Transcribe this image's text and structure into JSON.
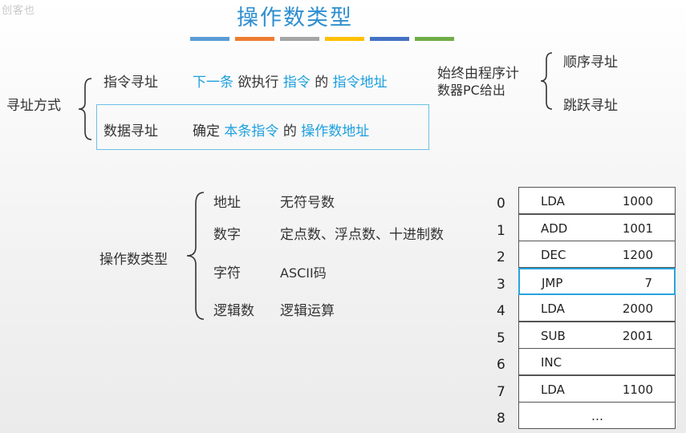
{
  "watermark": "创客也",
  "title": "操作数类型",
  "color_bars": [
    "#5b9bd5",
    "#ed7d31",
    "#a5a5a5",
    "#ffc000",
    "#4472c4",
    "#70ad47"
  ],
  "addressing": {
    "root": "寻址方式",
    "instruction": {
      "label": "指令寻址",
      "p1": "下一条",
      "p2": "欲执行",
      "p3": "指令",
      "p4": "的",
      "p5": "指令地址"
    },
    "pc_note_line1": "始终由程序计",
    "pc_note_line2": "数器PC给出",
    "seq": "顺序寻址",
    "jump": "跳跃寻址",
    "data": {
      "label": "数据寻址",
      "p1": "确定",
      "p2": "本条指令",
      "p3": "的",
      "p4": "操作数地址"
    }
  },
  "operand_types": {
    "root": "操作数类型",
    "items": [
      {
        "name": "地址",
        "desc": "无符号数"
      },
      {
        "name": "数字",
        "desc": "定点数、浮点数、十进制数"
      },
      {
        "name": "字符",
        "desc": "ASCII码"
      },
      {
        "name": "逻辑数",
        "desc": "逻辑运算"
      }
    ]
  },
  "memory": {
    "rows": [
      {
        "addr": "0",
        "op": "LDA",
        "arg": "1000"
      },
      {
        "addr": "1",
        "op": "ADD",
        "arg": "1001"
      },
      {
        "addr": "2",
        "op": "DEC",
        "arg": "1200"
      },
      {
        "addr": "3",
        "op": "JMP",
        "arg": "7"
      },
      {
        "addr": "4",
        "op": "LDA",
        "arg": "2000"
      },
      {
        "addr": "5",
        "op": "SUB",
        "arg": "2001"
      },
      {
        "addr": "6",
        "op": "INC",
        "arg": ""
      },
      {
        "addr": "7",
        "op": "LDA",
        "arg": "1100"
      },
      {
        "addr": "8",
        "op": "…",
        "arg": ""
      }
    ],
    "highlight_color": "#27a3dd"
  }
}
